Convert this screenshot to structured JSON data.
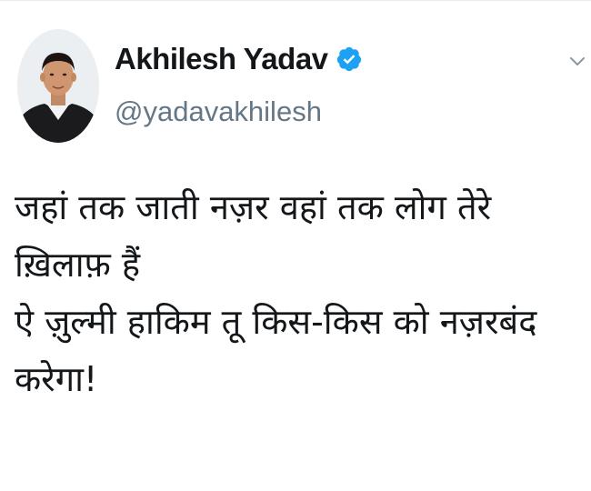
{
  "author": {
    "display_name": "Akhilesh Yadav",
    "handle": "@yadavakhilesh",
    "verified": true,
    "verified_icon": "verified-badge-icon",
    "verified_color": "#1da1f2"
  },
  "menu": {
    "icon": "chevron-down-icon",
    "color": "#8899a6"
  },
  "tweet": {
    "lines": [
      "जहां तक जाती नज़र वहां तक लोग तेरे",
      "ख़िलाफ़ हैं",
      "ऐ ज़ुल्मी हाकिम तू किस-किस को नज़रबंद",
      "करेगा!"
    ]
  },
  "colors": {
    "text": "#14171a",
    "secondary": "#657786",
    "background": "#ffffff"
  }
}
